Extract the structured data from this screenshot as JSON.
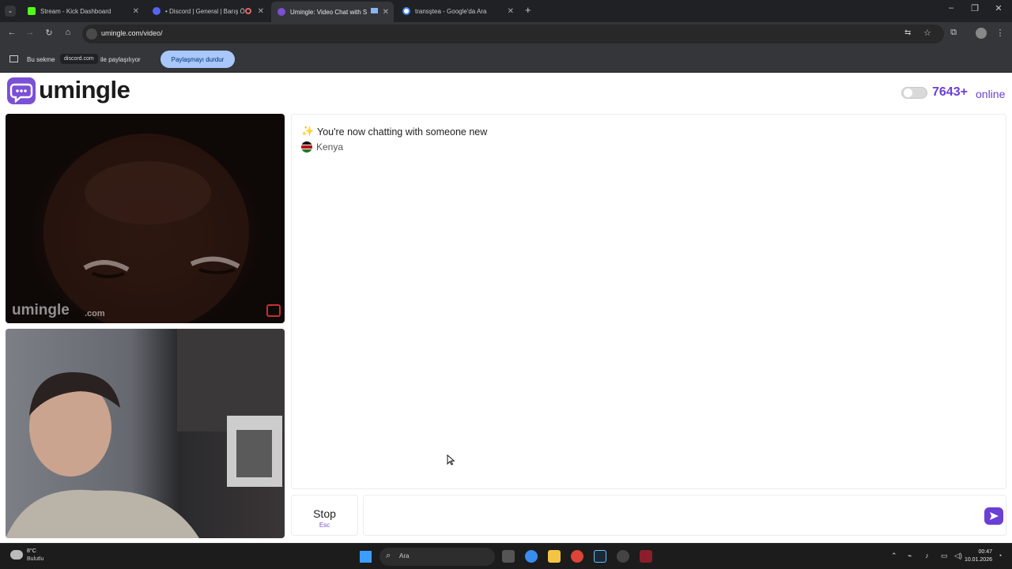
{
  "browser": {
    "tabs": [
      {
        "title": "Stream - Kick Dashboard",
        "favicon_color": "#53fc18",
        "active": false
      },
      {
        "title": "• Discord | General | Barış Ö",
        "favicon_color": "#5865f2",
        "active": false
      },
      {
        "title": "Umingle: Video Chat with S",
        "favicon_color": "#7b4fd6",
        "active": true
      },
      {
        "title": "transştea - Google'da Ara",
        "favicon_color": "#ffffff",
        "active": false
      }
    ],
    "url": "umingle.com/video/",
    "share_bar": {
      "prefix": "Bu sekme",
      "domain": "discord.com",
      "suffix": "ile paylaşılıyor",
      "stop_button": "Paylaşmayı durdur"
    }
  },
  "header": {
    "logo_text": "umingle",
    "online_count": "7643+",
    "online_label": "online"
  },
  "video": {
    "watermark": "umingle",
    "watermark_suffix": ".com"
  },
  "chat": {
    "status_message": "You're now chatting with someone new",
    "country": "Kenya"
  },
  "controls": {
    "stop_label": "Stop",
    "stop_hint": "Esc",
    "message_placeholder": ""
  },
  "taskbar": {
    "weather_temp": "8°C",
    "weather_desc": "Bulutlu",
    "search_label": "Ara",
    "time": "00:47",
    "date": "10.01.2026"
  },
  "colors": {
    "brand": "#7b4fd6",
    "accent": "#6b3fd4",
    "share_button": "#a8c7fa"
  }
}
